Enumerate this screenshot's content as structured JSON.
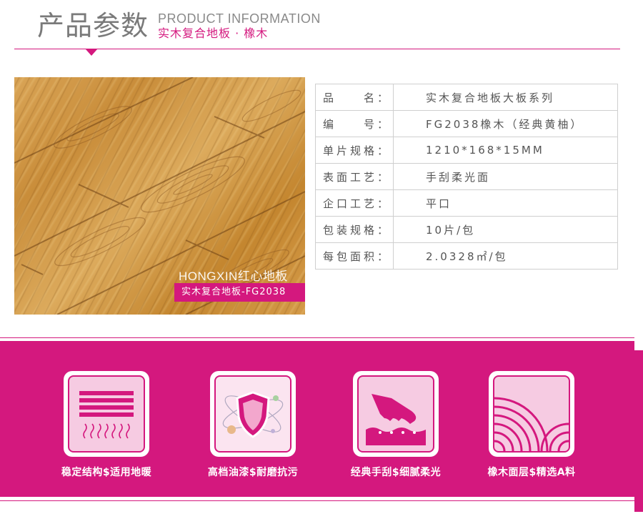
{
  "header": {
    "title_cn": "产品参数",
    "title_en": "PRODUCT INFORMATION",
    "subtitle": "实木复合地板 · 橡木"
  },
  "photo": {
    "watermark": "HONGXIN红心地板",
    "tag": "实木复合地板-FG2038"
  },
  "specs": [
    {
      "label": "品　　名：",
      "value": "实木复合地板大板系列"
    },
    {
      "label": "编　　号：",
      "value": "FG2038橡木（经典黄柚）"
    },
    {
      "label": "单片规格：",
      "value": "1210*168*15MM"
    },
    {
      "label": "表面工艺：",
      "value": "手刮柔光面"
    },
    {
      "label": "企口工艺：",
      "value": "平口"
    },
    {
      "label": "包装规格：",
      "value": "10片/包"
    },
    {
      "label": "每包面积：",
      "value": "2.0328㎡/包"
    }
  ],
  "features": [
    {
      "caption": "稳定结构$适用地暖",
      "icon": "stable-structure-heating-icon"
    },
    {
      "caption": "高档油漆$耐磨抗污",
      "icon": "shield-atom-icon"
    },
    {
      "caption": "经典手刮$细腻柔光",
      "icon": "hand-scrape-icon"
    },
    {
      "caption": "橡木面层$精选A料",
      "icon": "wood-rings-icon"
    }
  ],
  "colors": {
    "accent": "#d4187e",
    "icon_bg": "#f6cbe2",
    "text": "#555555",
    "wood": "#d19a4a"
  }
}
